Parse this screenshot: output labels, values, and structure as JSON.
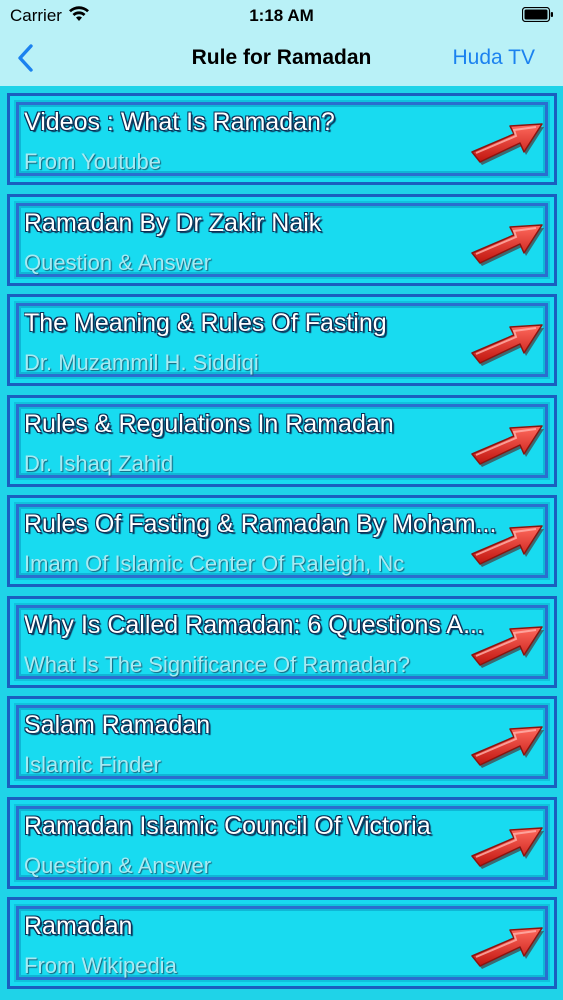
{
  "status": {
    "carrier": "Carrier",
    "time": "1:18 AM",
    "wifi_icon": "wifi-icon",
    "battery_icon": "battery-icon"
  },
  "nav": {
    "title": "Rule for Ramadan",
    "right_label": "Huda TV",
    "back_icon": "chevron-left-icon",
    "accent": "#1b82ef"
  },
  "rows": [
    {
      "title": "Videos : What Is Ramadan?",
      "subtitle": "From Youtube"
    },
    {
      "title": "Ramadan By Dr Zakir Naik",
      "subtitle": "Question & Answer"
    },
    {
      "title": "The Meaning & Rules Of Fasting",
      "subtitle": "Dr. Muzammil H. Siddiqi"
    },
    {
      "title": "Rules & Regulations In Ramadan",
      "subtitle": "Dr. Ishaq Zahid"
    },
    {
      "title": "Rules Of Fasting & Ramadan By Moham...",
      "subtitle": "Imam Of Islamic Center Of Raleigh, Nc"
    },
    {
      "title": "Why Is Called Ramadan: 6 Questions A...",
      "subtitle": "What Is The Significance Of Ramadan?"
    },
    {
      "title": "Salam Ramadan",
      "subtitle": "Islamic Finder"
    },
    {
      "title": "Ramadan Islamic Council Of Victoria",
      "subtitle": "Question & Answer"
    },
    {
      "title": "Ramadan",
      "subtitle": "From Wikipedia"
    }
  ],
  "row_icon": "red-arrow-icon",
  "colors": {
    "background": "#1fd3e8",
    "bar": "#b9f1f7",
    "border": "#1a5fbf",
    "arrow": "#e8332c"
  }
}
